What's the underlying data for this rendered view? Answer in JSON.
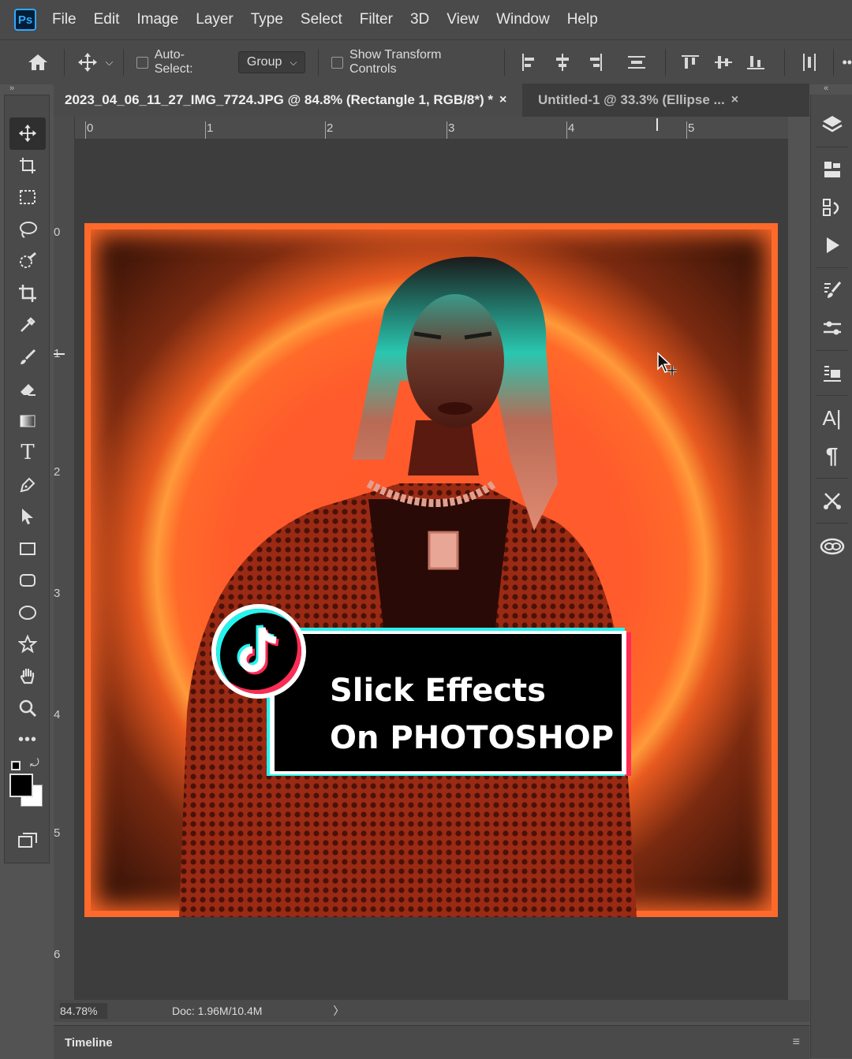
{
  "app": {
    "logo": "Ps"
  },
  "menu": [
    "File",
    "Edit",
    "Image",
    "Layer",
    "Type",
    "Select",
    "Filter",
    "3D",
    "View",
    "Window",
    "Help"
  ],
  "options": {
    "auto_select_label": "Auto-Select:",
    "group_value": "Group",
    "show_transform_label": "Show Transform Controls"
  },
  "tabs": [
    {
      "title": "2023_04_06_11_27_IMG_7724.JPG @ 84.8% (Rectangle 1, RGB/8*) *",
      "close": "×"
    },
    {
      "title": "Untitled-1 @ 33.3% (Ellipse ...",
      "close": "×"
    }
  ],
  "ruler": {
    "top_labels": [
      "0",
      "1",
      "2",
      "3",
      "4",
      "5"
    ],
    "left_labels": [
      "0",
      "1",
      "2",
      "3",
      "4",
      "5",
      "6"
    ]
  },
  "status": {
    "zoom": "84.78%",
    "doc": "Doc: 1.96M/10.4M",
    "arrow": "〉"
  },
  "timeline": {
    "label": "Timeline"
  },
  "overlay": {
    "line1": "Slick Effects",
    "line2": "On PHOTOSHOP"
  },
  "colors": {
    "ps_blue": "#31a8ff",
    "tiktok_cyan": "#25f4ee",
    "tiktok_red": "#fe2c55",
    "canvas_orange": "#ff5a2a"
  },
  "tools": [
    "move-icon",
    "artboard-icon",
    "marquee-icon",
    "lasso-icon",
    "quick-select-icon",
    "crop-icon",
    "eyedropper-icon",
    "brush-icon",
    "eraser-icon",
    "gradient-icon",
    "type-icon",
    "pen-icon",
    "path-select-icon",
    "rectangle-icon",
    "rounded-rect-icon",
    "ellipse-icon",
    "custom-shape-icon",
    "hand-icon",
    "zoom-icon",
    "more-tools-icon"
  ],
  "right_panels": [
    "layers-icon",
    "libraries-icon",
    "history-icon",
    "actions-icon",
    "brushes-icon",
    "adjustments-icon",
    "properties-icon",
    "character-icon",
    "paragraph-icon",
    "tools-panel-icon",
    "creative-cloud-icon"
  ]
}
